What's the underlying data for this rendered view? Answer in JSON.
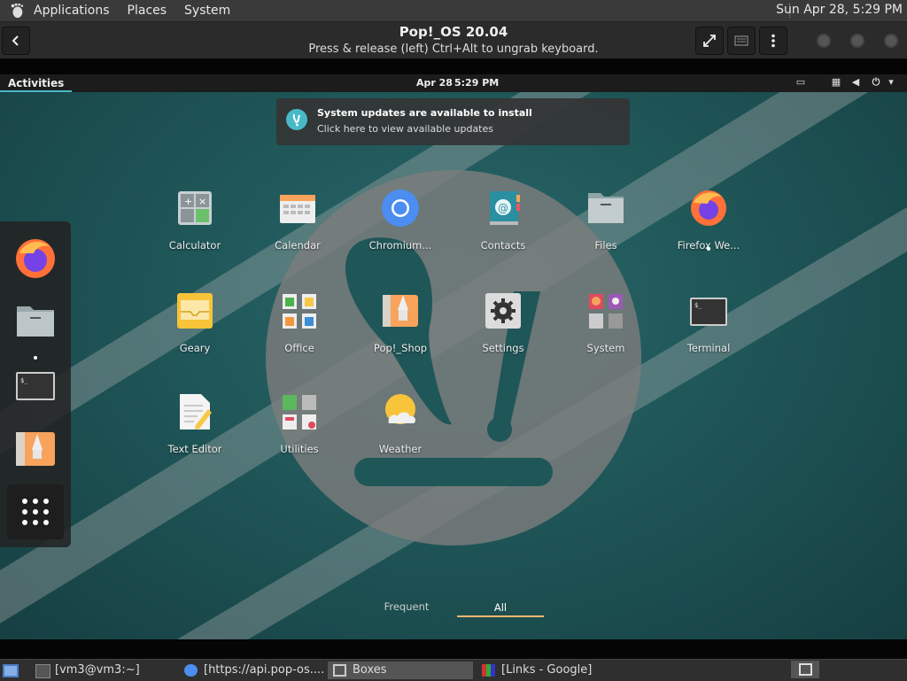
{
  "host_panel": {
    "menus": [
      "Applications",
      "Places",
      "System"
    ],
    "clock": "Sun Apr 28,  5:29 PM"
  },
  "boxes": {
    "title": "Pop!_OS 20.04",
    "subtitle": "Press & release (left) Ctrl+Alt to ungrab keyboard."
  },
  "guest": {
    "activities": "Activities",
    "date": "Apr 28",
    "time": "5:29 PM",
    "notification": {
      "title": "System updates are available to install",
      "body": "Click here to view available updates"
    },
    "apps": [
      {
        "label": "Calculator",
        "icon": "calculator-icon"
      },
      {
        "label": "Calendar",
        "icon": "calendar-icon"
      },
      {
        "label": "Chromium...",
        "icon": "chromium-icon"
      },
      {
        "label": "Contacts",
        "icon": "contacts-icon"
      },
      {
        "label": "Files",
        "icon": "files-icon"
      },
      {
        "label": "Firefox We...",
        "icon": "firefox-icon"
      },
      {
        "label": "Geary",
        "icon": "geary-icon"
      },
      {
        "label": "Office",
        "icon": "office-folder-icon"
      },
      {
        "label": "Pop!_Shop",
        "icon": "pop-shop-icon"
      },
      {
        "label": "Settings",
        "icon": "settings-gear-icon"
      },
      {
        "label": "System",
        "icon": "system-folder-icon"
      },
      {
        "label": "Terminal",
        "icon": "terminal-icon"
      },
      {
        "label": "Text Editor",
        "icon": "text-editor-icon"
      },
      {
        "label": "Utilities",
        "icon": "utilities-folder-icon"
      },
      {
        "label": "Weather",
        "icon": "weather-icon"
      }
    ],
    "tabs": {
      "frequent": "Frequent",
      "all": "All",
      "selected": "All"
    }
  },
  "taskbar": {
    "items": [
      {
        "label": "[vm3@vm3:~]",
        "icon": "terminal-small-icon"
      },
      {
        "label": "[https://api.pop-os....",
        "icon": "chromium-small-icon"
      },
      {
        "label": "Boxes",
        "icon": "boxes-icon"
      },
      {
        "label": "[Links - Google]",
        "icon": "links-icon"
      }
    ]
  },
  "colors": {
    "accent": "#48b9c7",
    "tab_underline": "#fbb86c",
    "wallpaper": "#1f5658"
  }
}
